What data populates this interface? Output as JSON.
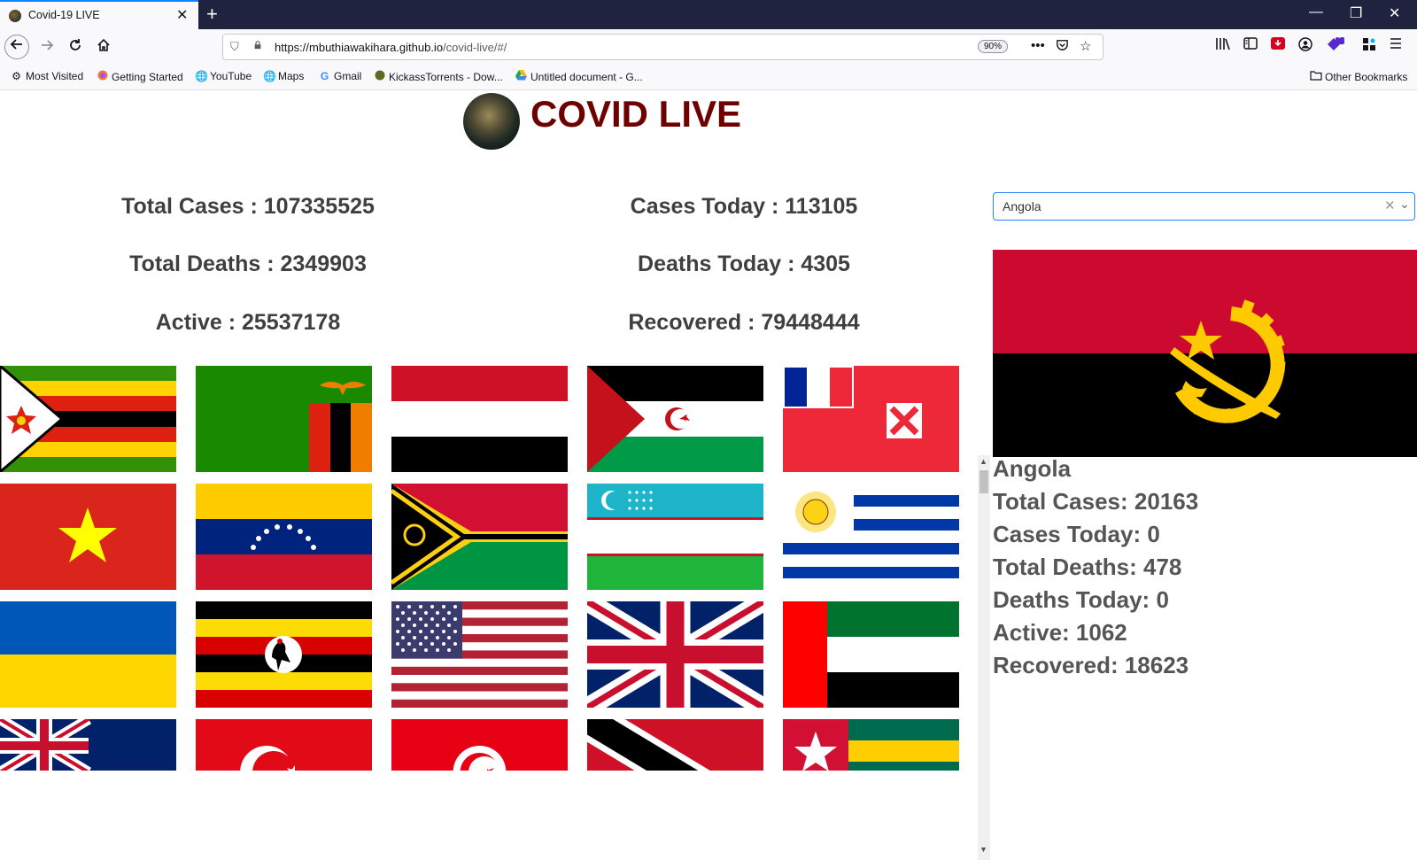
{
  "browser": {
    "tab_title": "Covid-19 LIVE",
    "tab_close": "✕",
    "new_tab": "+",
    "window_controls": {
      "minimize": "—",
      "restore": "❐",
      "close": "✕"
    },
    "url_host": "https://mbuthiawakihara.github.io",
    "url_path": "/covid-live/#/",
    "zoom": "90%",
    "bookmarks": [
      {
        "label": "Most Visited",
        "icon": "gear-icon"
      },
      {
        "label": "Getting Started",
        "icon": "firefox-icon"
      },
      {
        "label": "YouTube",
        "icon": "globe-icon"
      },
      {
        "label": "Maps",
        "icon": "globe-icon"
      },
      {
        "label": "Gmail",
        "icon": "google-icon"
      },
      {
        "label": "KickassTorrents - Dow...",
        "icon": "kickass-icon"
      },
      {
        "label": "Untitled document - G...",
        "icon": "drive-icon"
      }
    ],
    "other_bookmarks": "Other Bookmarks",
    "extension_badge": "6"
  },
  "header": {
    "title": "COVID LIVE"
  },
  "global_stats": {
    "total_cases": "Total Cases : 107335525",
    "cases_today": "Cases Today : 113105",
    "total_deaths": "Total Deaths : 2349903",
    "deaths_today": "Deaths Today : 4305",
    "active": "Active : 25537178",
    "recovered": "Recovered : 79448444"
  },
  "flags": [
    "Zimbabwe",
    "Zambia",
    "Yemen",
    "Western Sahara",
    "Wallis and Futuna",
    "Vietnam",
    "Venezuela",
    "Vanuatu",
    "Uzbekistan",
    "Uruguay",
    "Ukraine",
    "Uganda",
    "USA",
    "UK",
    "UAE",
    "Turks and Caicos Islands",
    "Turkey",
    "Tunisia",
    "Trinidad and Tobago",
    "Togo"
  ],
  "country_select": {
    "value": "Angola",
    "clear": "✕",
    "arrow": "⌄"
  },
  "country_stats": {
    "name": "Angola",
    "total_cases": "Total Cases: 20163",
    "cases_today": "Cases Today: 0",
    "total_deaths": "Total Deaths: 478",
    "deaths_today": "Deaths Today: 0",
    "active": "Active: 1062",
    "recovered": "Recovered: 18623"
  },
  "colors": {
    "brand": "#6e0000",
    "focus": "#2684ff",
    "tabbar": "#202340"
  }
}
